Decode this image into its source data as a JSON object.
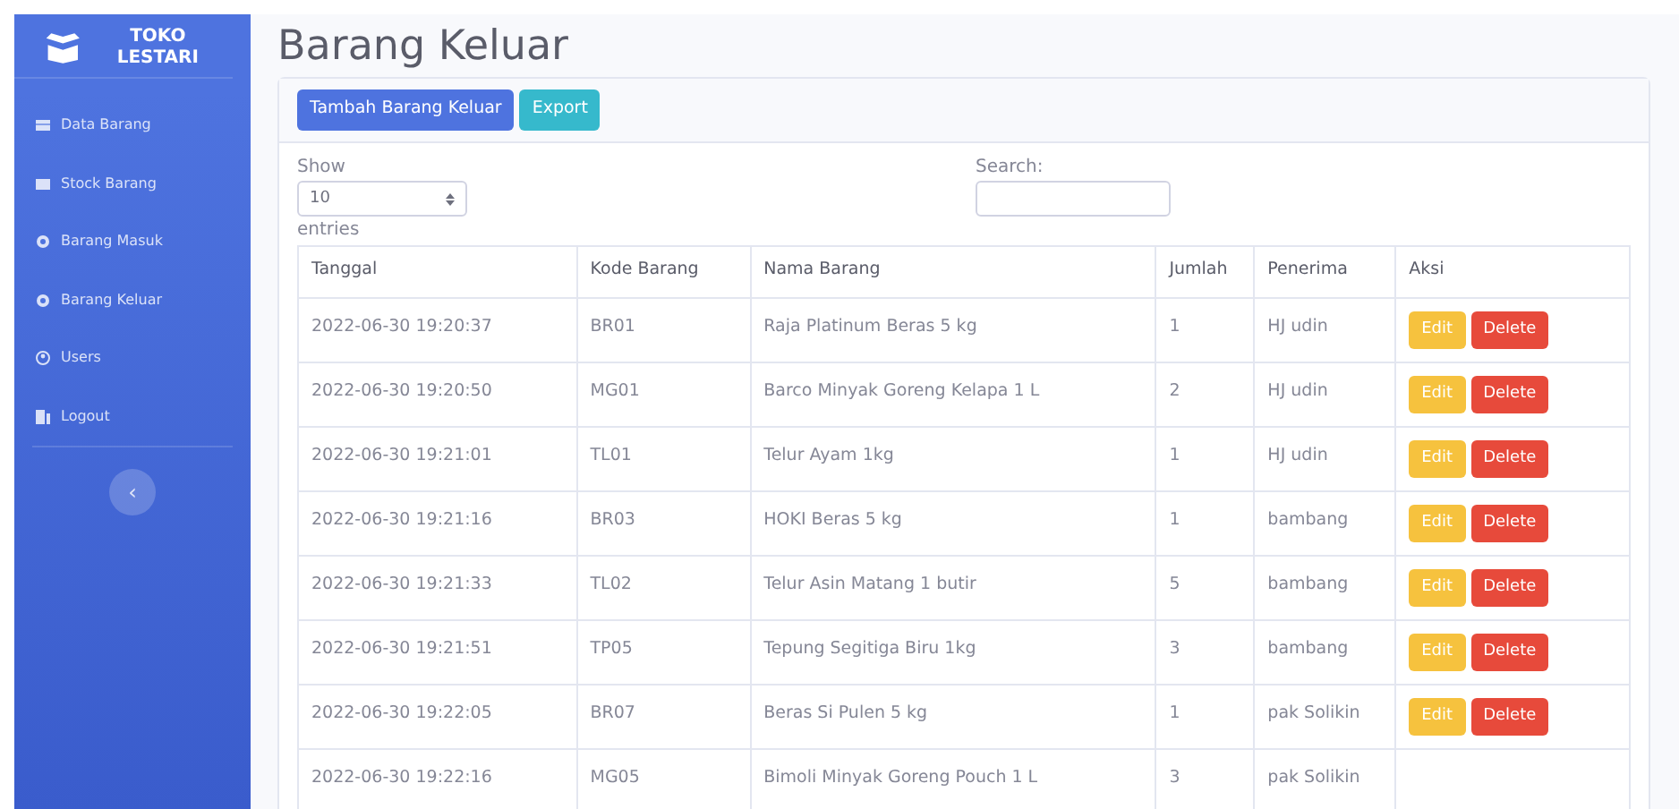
{
  "brand": {
    "name": "TOKO LESTARI"
  },
  "sidebar": {
    "items": [
      {
        "label": "Data Barang",
        "kind": "table"
      },
      {
        "label": "Stock Barang",
        "kind": "box"
      },
      {
        "label": "Barang Masuk",
        "kind": "circle"
      },
      {
        "label": "Barang Keluar",
        "kind": "circle"
      },
      {
        "label": "Users",
        "kind": "user"
      },
      {
        "label": "Logout",
        "kind": "door"
      }
    ],
    "toggle": "‹"
  },
  "page": {
    "title": "Barang Keluar"
  },
  "toolbar": {
    "buttons": [
      {
        "label": "Tambah Barang Keluar",
        "kind": "primary"
      },
      {
        "label": "Export",
        "kind": "info"
      }
    ]
  },
  "datatable": {
    "length_label_before": "Show",
    "length_value": "10",
    "length_label_after": "entries",
    "search_label": "Search:"
  },
  "table": {
    "columns": [
      "Tanggal",
      "Kode Barang",
      "Nama Barang",
      "Jumlah",
      "Penerima",
      "Aksi"
    ],
    "rows": [
      {
        "cells": [
          "2022-06-30 19:20:37",
          "BR01",
          "Raja Platinum Beras 5 kg",
          "1",
          "HJ udin"
        ],
        "actions": [
          "Edit",
          "Delete"
        ]
      },
      {
        "cells": [
          "2022-06-30 19:20:50",
          "MG01",
          "Barco Minyak Goreng Kelapa 1 L",
          "2",
          "HJ udin"
        ],
        "actions": [
          "Edit",
          "Delete"
        ]
      },
      {
        "cells": [
          "2022-06-30 19:21:01",
          "TL01",
          "Telur Ayam 1kg",
          "1",
          "HJ udin"
        ],
        "actions": [
          "Edit",
          "Delete"
        ]
      },
      {
        "cells": [
          "2022-06-30 19:21:16",
          "BR03",
          "HOKI Beras 5 kg",
          "1",
          "bambang"
        ],
        "actions": [
          "Edit",
          "Delete"
        ]
      },
      {
        "cells": [
          "2022-06-30 19:21:33",
          "TL02",
          "Telur Asin Matang 1 butir",
          "5",
          "bambang"
        ],
        "actions": [
          "Edit",
          "Delete"
        ]
      },
      {
        "cells": [
          "2022-06-30 19:21:51",
          "TP05",
          "Tepung Segitiga Biru 1kg",
          "3",
          "bambang"
        ],
        "actions": [
          "Edit",
          "Delete"
        ]
      },
      {
        "cells": [
          "2022-06-30 19:22:05",
          "BR07",
          "Beras Si Pulen 5 kg",
          "1",
          "pak Solikin"
        ],
        "actions": [
          "Edit",
          "Delete"
        ]
      },
      {
        "cells": [
          "2022-06-30 19:22:16",
          "MG05",
          "Bimoli Minyak Goreng Pouch 1 L",
          "3",
          "pak Solikin"
        ]
      }
    ]
  }
}
